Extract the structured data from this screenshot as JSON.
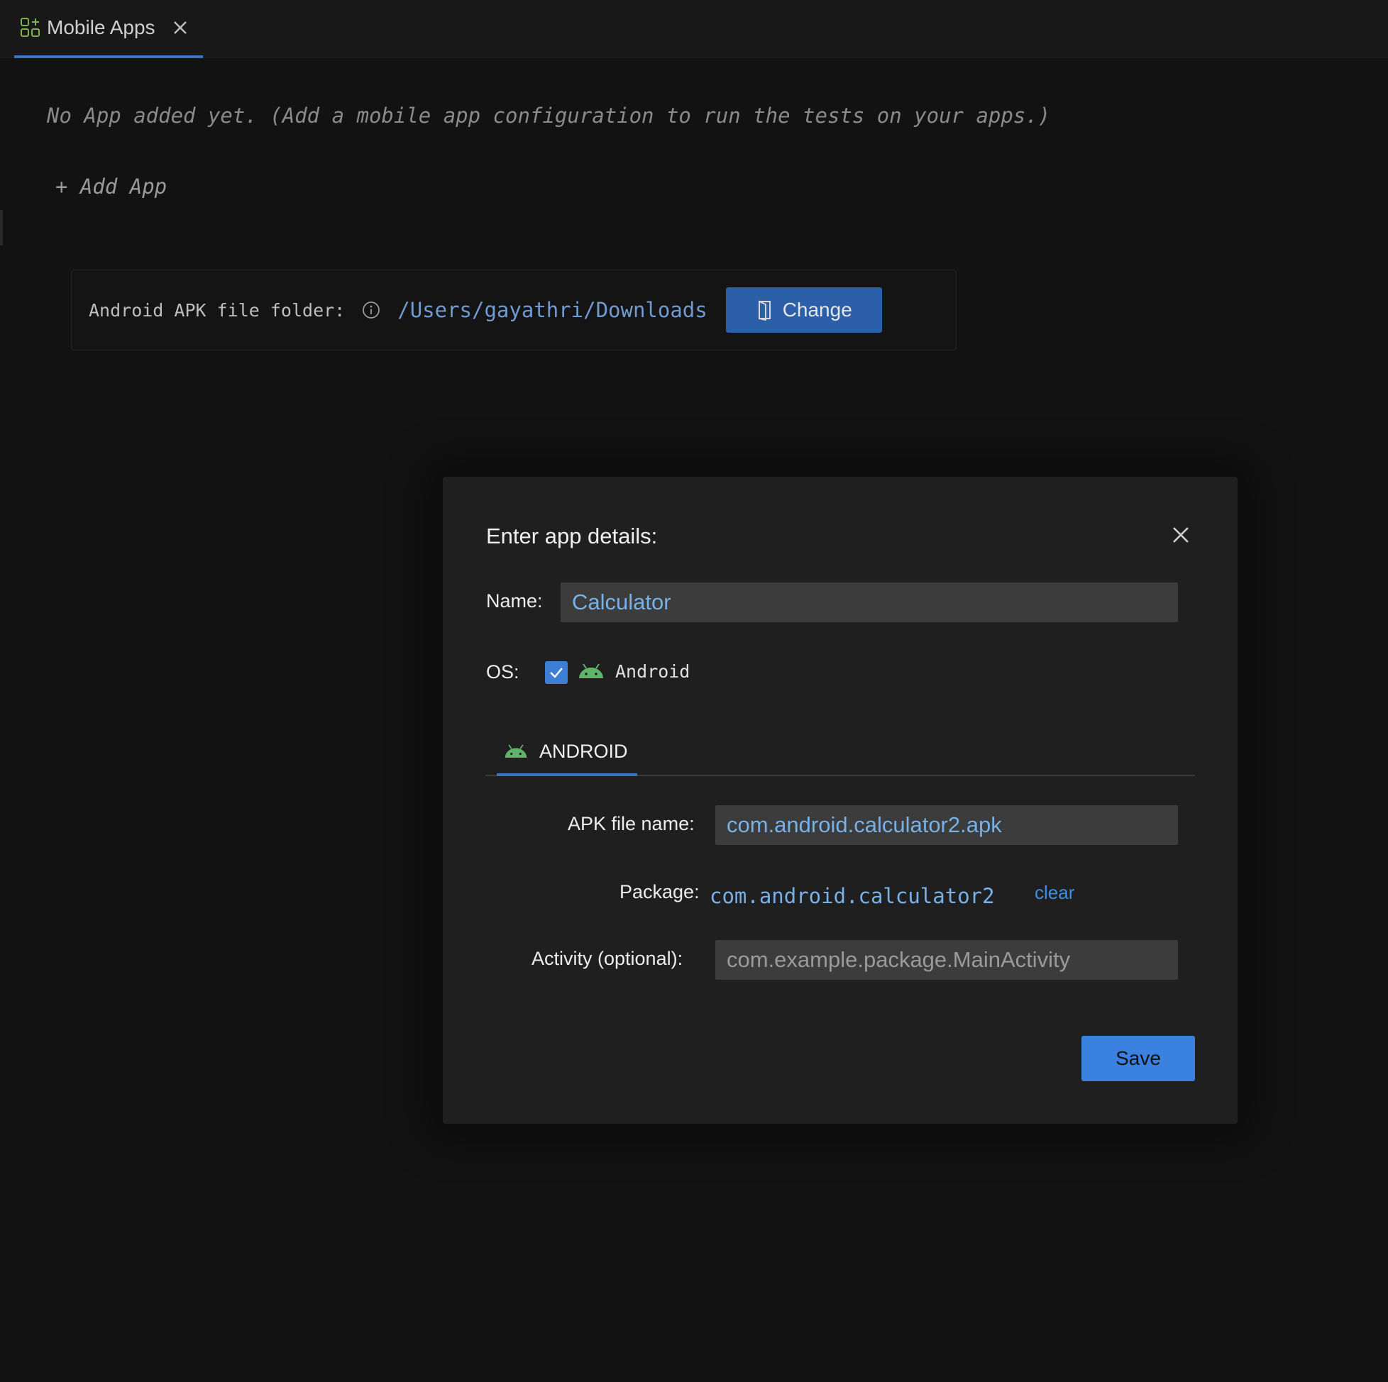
{
  "tab": {
    "label": "Mobile Apps",
    "icon": "apps-add-icon"
  },
  "empty_state": {
    "message": "No App added yet. (Add a mobile app configuration to run the tests on your apps.)",
    "add_app_label": "+ Add App"
  },
  "apk_folder": {
    "label": "Android APK file folder:",
    "path": "/Users/gayathri/Downloads",
    "change_label": "Change"
  },
  "dialog": {
    "title": "Enter app details:",
    "name_label": "Name:",
    "name_value": "Calculator",
    "os_label": "OS:",
    "os_android_checked": true,
    "os_android_label": "Android",
    "tab_android_label": "ANDROID",
    "apk_file_label": "APK file name:",
    "apk_file_value": "com.android.calculator2.apk",
    "package_label": "Package:",
    "package_value": "com.android.calculator2",
    "clear_label": "clear",
    "activity_label": "Activity (optional):",
    "activity_placeholder": "com.example.package.MainActivity",
    "save_label": "Save"
  },
  "colors": {
    "accent": "#3b82e0",
    "link": "#78b0e8",
    "android_green": "#5fb36b",
    "background": "#121212",
    "dialog_background": "#1f1f1f"
  }
}
